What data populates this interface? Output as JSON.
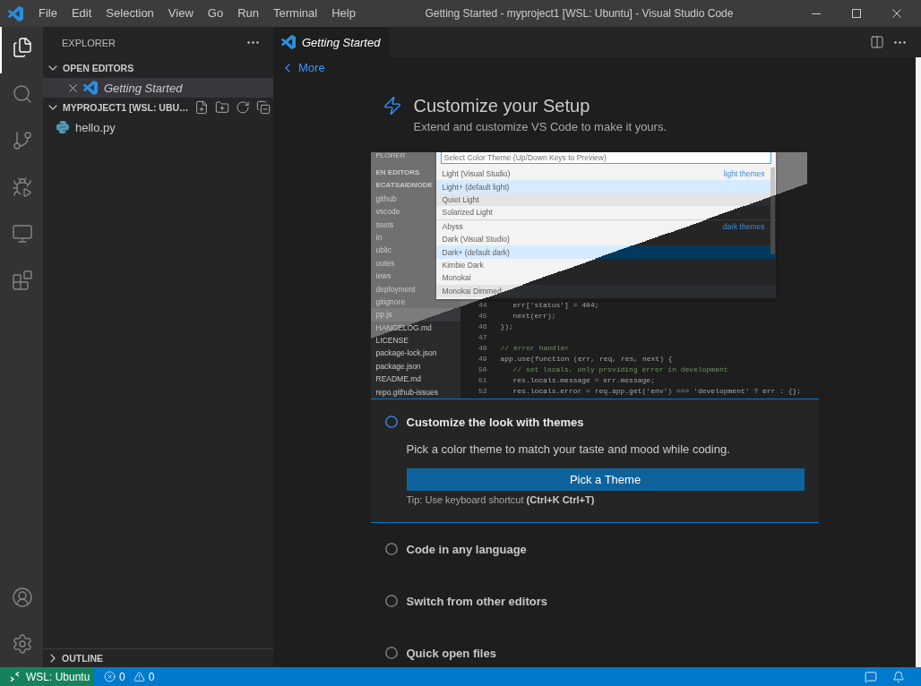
{
  "title_bar": {
    "menu": [
      "File",
      "Edit",
      "Selection",
      "View",
      "Go",
      "Run",
      "Terminal",
      "Help"
    ],
    "title": "Getting Started - myproject1 [WSL: Ubuntu] - Visual Studio Code"
  },
  "activity_bar": {
    "items": [
      {
        "kind": "explorer",
        "selected": true
      },
      {
        "kind": "search",
        "selected": false
      },
      {
        "kind": "source-control",
        "selected": false
      },
      {
        "kind": "run-debug",
        "selected": false
      },
      {
        "kind": "remote-explorer",
        "selected": false
      },
      {
        "kind": "extensions",
        "selected": false
      }
    ],
    "bottom_items": [
      {
        "kind": "accounts"
      },
      {
        "kind": "manage"
      }
    ]
  },
  "sidebar": {
    "title": "EXPLORER",
    "sections": [
      {
        "kind": "open-editors",
        "title": "OPEN EDITORS",
        "expanded": true,
        "items": [
          {
            "kind": "vscode",
            "label": "Getting Started",
            "selected": true
          }
        ]
      },
      {
        "kind": "folder",
        "title": "MYPROJECT1 [WSL: UBU…",
        "expanded": true,
        "items": [
          {
            "kind": "python",
            "label": "hello.py",
            "selected": false
          }
        ]
      }
    ],
    "outline": {
      "title": "OUTLINE",
      "expanded": false
    }
  },
  "editor": {
    "tabs": [
      {
        "label": "Getting Started",
        "selected": true
      }
    ],
    "walkthrough": {
      "back_link": "More",
      "title": "Customize your Setup",
      "subtitle": "Extend and customize VS Code to make it yours.",
      "preview": {
        "sidebar": [
          {
            "kind": "title",
            "label": "PLORER",
            "selected": false
          },
          {
            "kind": "section",
            "label": "EN EDITORS",
            "selected": false
          },
          {
            "kind": "section",
            "label": "ECATSAIDNODE",
            "selected": false
          },
          {
            "kind": "file",
            "label": "github",
            "selected": false
          },
          {
            "kind": "file",
            "label": "vscode",
            "selected": false
          },
          {
            "kind": "file",
            "label": "ssets",
            "selected": false
          },
          {
            "kind": "file",
            "label": "in",
            "selected": false
          },
          {
            "kind": "file",
            "label": "ublic",
            "selected": false
          },
          {
            "kind": "file",
            "label": "outes",
            "selected": false
          },
          {
            "kind": "file",
            "label": "iews",
            "selected": false
          },
          {
            "kind": "file",
            "label": "deployment",
            "selected": false
          },
          {
            "kind": "file",
            "label": "gitignore",
            "selected": false
          },
          {
            "kind": "file",
            "label": "pp.js",
            "selected": true
          },
          {
            "kind": "file",
            "label": "HANGELOG.md",
            "selected": false
          },
          {
            "kind": "file",
            "label": "LICENSE",
            "selected": false
          },
          {
            "kind": "file",
            "label": "package-lock.json",
            "selected": false
          },
          {
            "kind": "file",
            "label": "package.json",
            "selected": false
          },
          {
            "kind": "file",
            "label": "README.md",
            "selected": false
          },
          {
            "kind": "file",
            "label": "repo.github-issues",
            "selected": false
          }
        ],
        "picker": {
          "placeholder": "Select Color Theme (Up/Down Keys to Preview)",
          "items": [
            {
              "label": "Light (Visual Studio)",
              "group": "light themes",
              "selected": false,
              "hovered": false
            },
            {
              "label": "Light+ (default light)",
              "selected": true,
              "hovered": false
            },
            {
              "label": "Quiet Light",
              "selected": false,
              "hovered": true
            },
            {
              "label": "Solarized Light",
              "selected": false,
              "hovered": false
            },
            {
              "label": "Abyss",
              "group": "dark themes",
              "selected": false,
              "hovered": false
            },
            {
              "label": "Dark (Visual Studio)",
              "selected": false,
              "hovered": false
            },
            {
              "label": "Dark+ (default dark)",
              "selected": true,
              "hovered": false
            },
            {
              "label": "Kimbie Dark",
              "selected": false,
              "hovered": false
            },
            {
              "label": "Monokai",
              "selected": false,
              "hovered": false
            },
            {
              "label": "Monokai Dimmed",
              "selected": false,
              "hovered": true
            }
          ]
        },
        "code": [
          {
            "number": "44",
            "text": "  err['status'] = 404;",
            "kind": "code"
          },
          {
            "number": "45",
            "text": "  next(err);",
            "kind": "code"
          },
          {
            "number": "46",
            "text": "});",
            "kind": "code"
          },
          {
            "number": "47"
          },
          {
            "number": "48",
            "text": "// error handler",
            "kind": "comment"
          },
          {
            "number": "49",
            "text": "app.use(function (err, req, res, next) {",
            "kind": "code"
          },
          {
            "number": "50",
            "text": "  // set locals, only providing error in development",
            "kind": "comment"
          },
          {
            "number": "51",
            "text": "  res.locals.message = err.message;",
            "kind": "code"
          },
          {
            "number": "52",
            "text": "  res.locals.error = req.app.get('env') === 'development' ? err : {};",
            "kind": "code"
          }
        ]
      },
      "steps": [
        {
          "title": "Customize the look with themes",
          "expanded": true,
          "checked": false,
          "description": "Pick a color theme to match your taste and mood while coding.",
          "button": "Pick a Theme",
          "tip": "Tip: Use keyboard shortcut **(Ctrl+K Ctrl+T)**"
        },
        {
          "title": "Code in any language",
          "expanded": false,
          "checked": false
        },
        {
          "title": "Switch from other editors",
          "expanded": false,
          "checked": false
        },
        {
          "title": "Quick open files",
          "expanded": false,
          "checked": false
        }
      ]
    }
  },
  "status_bar": {
    "remote": "WSL: Ubuntu",
    "errors": "0",
    "warnings": "0"
  }
}
